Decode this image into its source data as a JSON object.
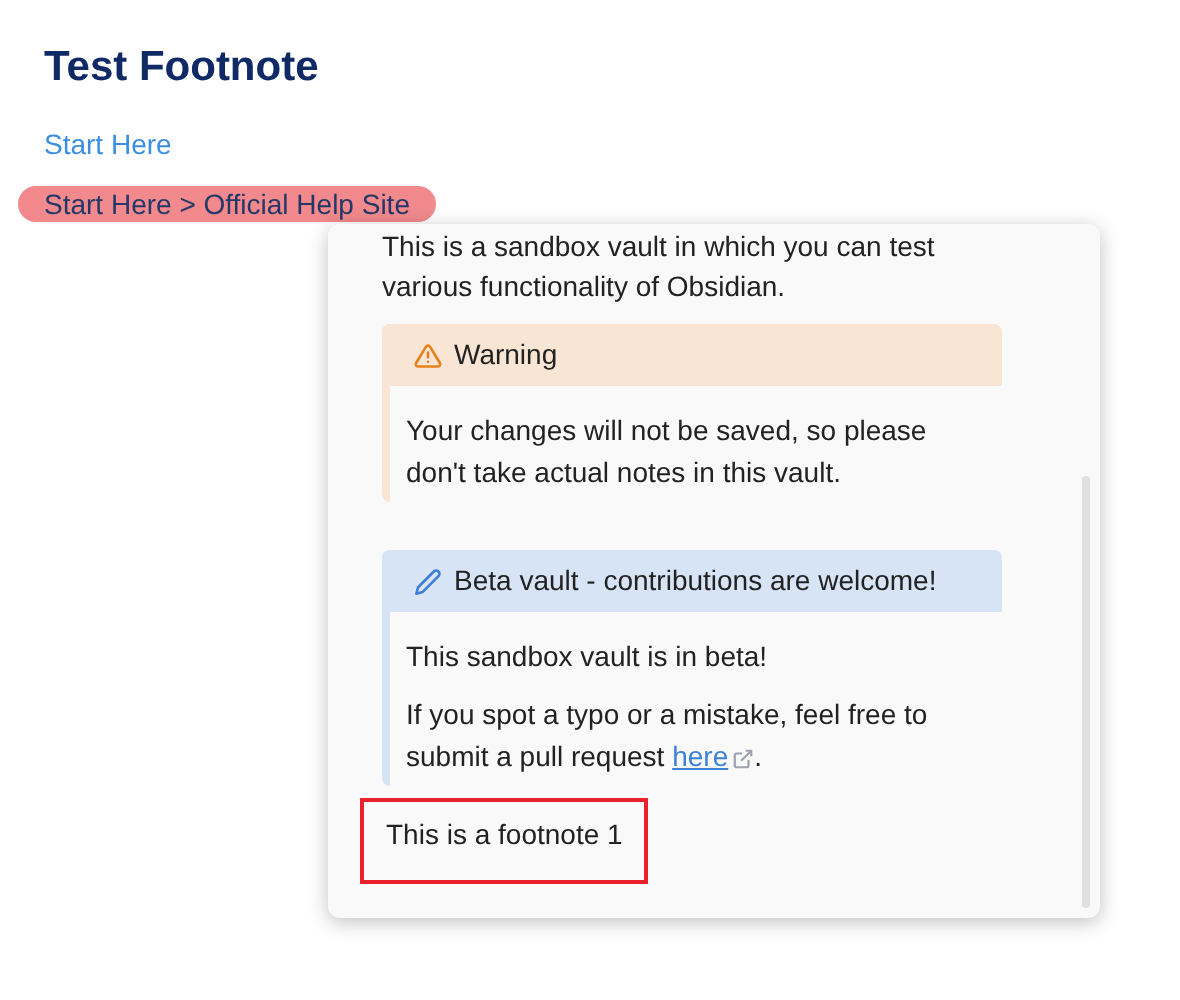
{
  "title": "Test Footnote",
  "link": "Start Here",
  "breadcrumb": "Start Here > Official Help Site",
  "popover": {
    "intro": "This is a sandbox vault in which you can test various functionality of Obsidian.",
    "callouts": [
      {
        "kind": "warning",
        "title": "Warning",
        "paragraphs": [
          "Your changes will not be saved, so please don't take actual notes in this vault."
        ]
      },
      {
        "kind": "info",
        "title": "Beta vault - contributions are welcome!",
        "paragraphs": [
          "This sandbox vault is in beta!"
        ],
        "last": {
          "text": "If you spot a typo or a mistake, feel free to submit a pull request ",
          "link": "here",
          "end": "."
        }
      }
    ],
    "footnote": "This is a footnote 1"
  }
}
